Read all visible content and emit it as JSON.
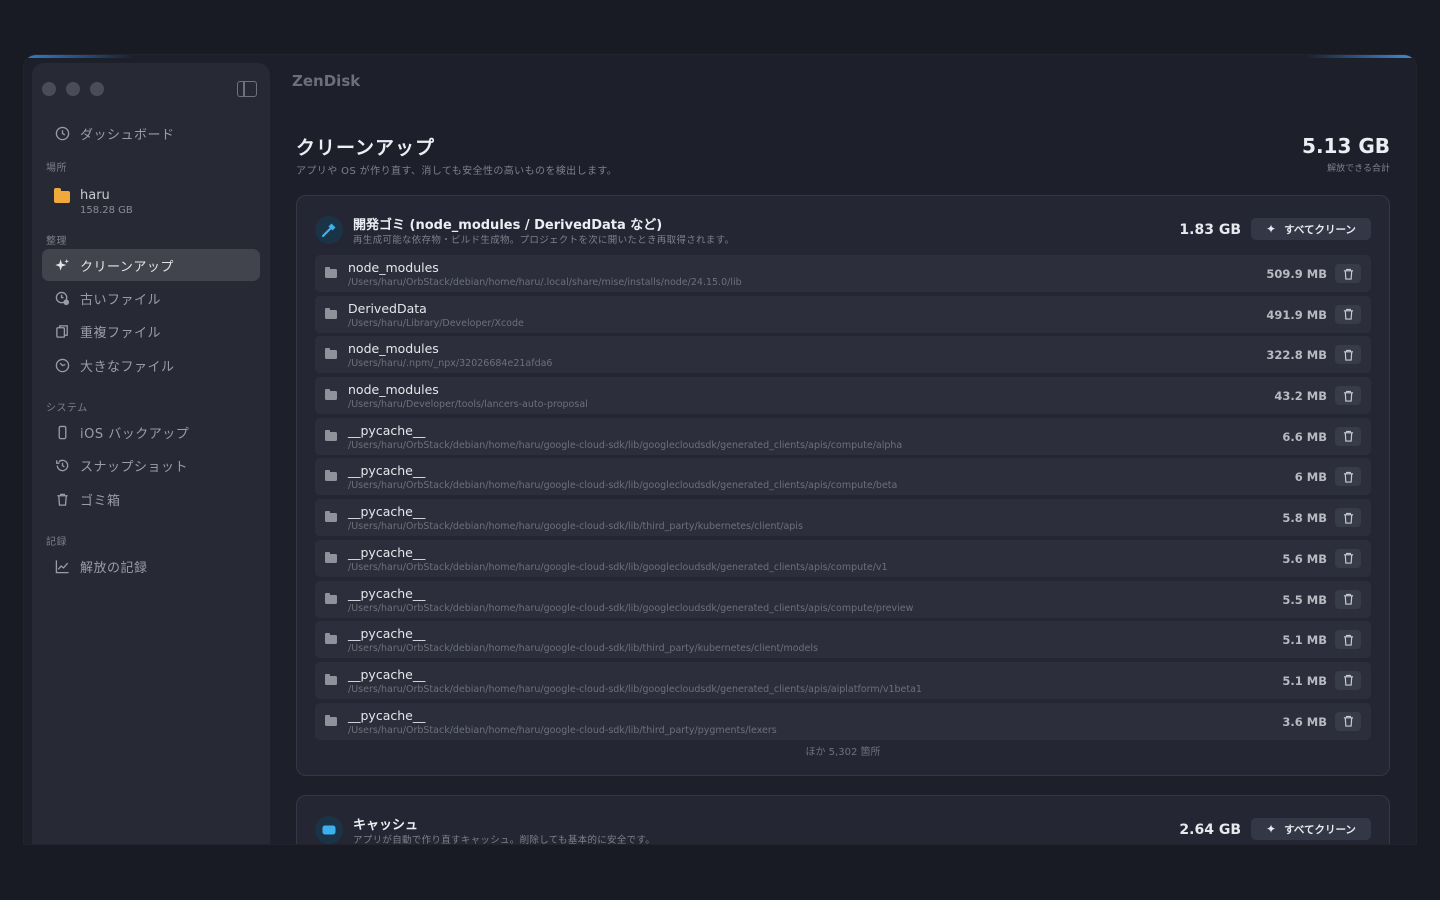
{
  "app": {
    "title": "ZenDisk"
  },
  "sidebar": {
    "dashboard": "ダッシュボード",
    "sections": {
      "places": "場所",
      "organize": "整理",
      "system": "システム",
      "records": "記録"
    },
    "location": {
      "name": "haru",
      "size": "158.28 GB"
    },
    "organize_items": [
      {
        "label": "クリーンアップ",
        "icon": "sparkle-icon"
      },
      {
        "label": "古いファイル",
        "icon": "clock-file-icon"
      },
      {
        "label": "重複ファイル",
        "icon": "duplicate-icon"
      },
      {
        "label": "大きなファイル",
        "icon": "gauge-icon"
      }
    ],
    "system_items": [
      {
        "label": "iOS バックアップ",
        "icon": "phone-icon"
      },
      {
        "label": "スナップショット",
        "icon": "history-icon"
      },
      {
        "label": "ゴミ箱",
        "icon": "trash-icon"
      }
    ],
    "record_items": [
      {
        "label": "解放の記録",
        "icon": "chart-line-icon"
      }
    ]
  },
  "main": {
    "title": "クリーンアップ",
    "subtitle": "アプリや OS が作り直す、消しても安全性の高いものを検出します。",
    "total_size": "5.13 GB",
    "total_label": "解放できる合計",
    "dev_card": {
      "title": "開発ゴミ (node_modules / DerivedData など)",
      "desc": "再生成可能な依存物・ビルド生成物。プロジェクトを次に開いたとき再取得されます。",
      "size": "1.83 GB",
      "clean_label": "すべてクリーン",
      "more": "ほか 5,302 箇所",
      "rows": [
        {
          "name": "node_modules",
          "path": "/Users/haru/OrbStack/debian/home/haru/.local/share/mise/installs/node/24.15.0/lib",
          "size": "509.9 MB"
        },
        {
          "name": "DerivedData",
          "path": "/Users/haru/Library/Developer/Xcode",
          "size": "491.9 MB"
        },
        {
          "name": "node_modules",
          "path": "/Users/haru/.npm/_npx/32026684e21afda6",
          "size": "322.8 MB"
        },
        {
          "name": "node_modules",
          "path": "/Users/haru/Developer/tools/lancers-auto-proposal",
          "size": "43.2 MB"
        },
        {
          "name": "__pycache__",
          "path": "/Users/haru/OrbStack/debian/home/haru/google-cloud-sdk/lib/googlecloudsdk/generated_clients/apis/compute/alpha",
          "size": "6.6 MB"
        },
        {
          "name": "__pycache__",
          "path": "/Users/haru/OrbStack/debian/home/haru/google-cloud-sdk/lib/googlecloudsdk/generated_clients/apis/compute/beta",
          "size": "6 MB"
        },
        {
          "name": "__pycache__",
          "path": "/Users/haru/OrbStack/debian/home/haru/google-cloud-sdk/lib/third_party/kubernetes/client/apis",
          "size": "5.8 MB"
        },
        {
          "name": "__pycache__",
          "path": "/Users/haru/OrbStack/debian/home/haru/google-cloud-sdk/lib/googlecloudsdk/generated_clients/apis/compute/v1",
          "size": "5.6 MB"
        },
        {
          "name": "__pycache__",
          "path": "/Users/haru/OrbStack/debian/home/haru/google-cloud-sdk/lib/googlecloudsdk/generated_clients/apis/compute/preview",
          "size": "5.5 MB"
        },
        {
          "name": "__pycache__",
          "path": "/Users/haru/OrbStack/debian/home/haru/google-cloud-sdk/lib/third_party/kubernetes/client/models",
          "size": "5.1 MB"
        },
        {
          "name": "__pycache__",
          "path": "/Users/haru/OrbStack/debian/home/haru/google-cloud-sdk/lib/googlecloudsdk/generated_clients/apis/aiplatform/v1beta1",
          "size": "5.1 MB"
        },
        {
          "name": "__pycache__",
          "path": "/Users/haru/OrbStack/debian/home/haru/google-cloud-sdk/lib/third_party/pygments/lexers",
          "size": "3.6 MB"
        }
      ]
    },
    "cache_card": {
      "title": "キャッシュ",
      "desc": "アプリが自動で作り直すキャッシュ。削除しても基本的に安全です。",
      "size": "2.64 GB",
      "clean_label": "すべてクリーン"
    }
  },
  "colors": {
    "accent": "#2f9be0",
    "folder": "#f2a93b"
  }
}
